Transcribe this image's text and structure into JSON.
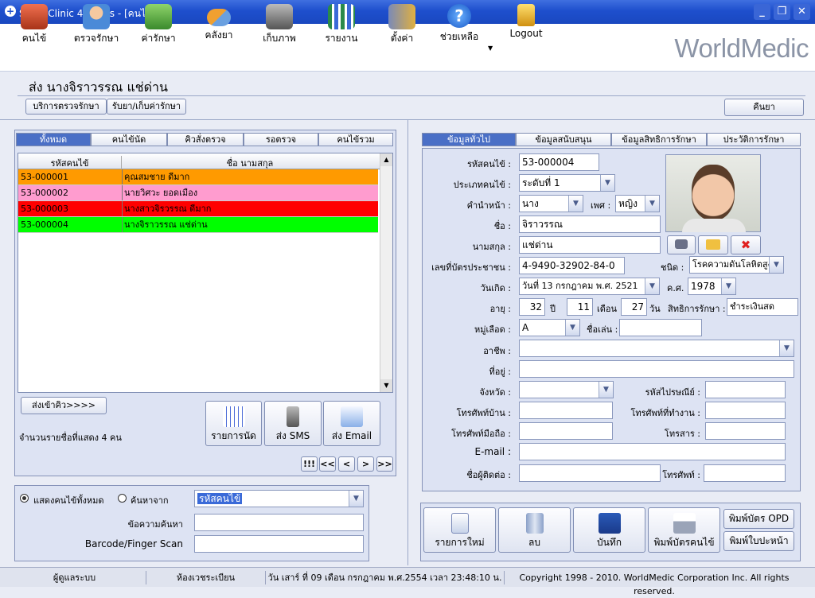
{
  "window": {
    "title": "SmartClinic 4.0 Plus - [คนไข้]"
  },
  "toolbar": {
    "items": [
      {
        "label": "คนไข้",
        "icon": "book-icon",
        "color": "#c84a2a"
      },
      {
        "label": "ตรวจรักษา",
        "icon": "doctor-icon",
        "color": "#4a8ad8"
      },
      {
        "label": "ค่ารักษา",
        "icon": "money-icon",
        "color": "#5aa83c"
      },
      {
        "label": "คลังยา",
        "icon": "pill-icon",
        "color": "#e08a2a"
      },
      {
        "label": "เก็บภาพ",
        "icon": "camera-icon",
        "color": "#6a6a6a"
      },
      {
        "label": "รายงาน",
        "icon": "chart-icon",
        "color": "#3a9a5a"
      },
      {
        "label": "ตั้งค่า",
        "icon": "tools-icon",
        "color": "#d0a030"
      },
      {
        "label": "ช่วยเหลือ",
        "icon": "help-icon",
        "color": "#2a7ad8"
      },
      {
        "label": "Logout",
        "icon": "lock-icon",
        "color": "#e8b830"
      }
    ],
    "brand": "WorldMedic"
  },
  "patient_header": {
    "name": "ส่ง  นางจิราวรรณ แช่ด่าน"
  },
  "subnav": {
    "service": "บริการตรวจรักษา",
    "pay": "รับยา/เก็บค่ารักษา",
    "reset": "คืนยา"
  },
  "left": {
    "tabs": [
      "ทั้งหมด",
      "คนไข้นัด",
      "คิวสั่งตรวจ",
      "รอตรวจ",
      "คนไข้รวม"
    ],
    "columns": [
      "รหัสคนไข้",
      "ชื่อ นามสกุล"
    ],
    "rows": [
      {
        "id": "53-000001",
        "name": "คุณสมชาย ดีมาก",
        "color": "#ff9a00"
      },
      {
        "id": "53-000002",
        "name": "นายวิศวะ ยอดเมือง",
        "color": "#ff9ccf"
      },
      {
        "id": "53-000003",
        "name": "นางสาวจิรวรรณ ดีมาก",
        "color": "#ff0000"
      },
      {
        "id": "53-000004",
        "name": "นางจิราวรรณ แช่ด่าน",
        "color": "#00ff00"
      }
    ],
    "send_queue": "ส่งเข้าคิว>>>>",
    "count_text": "จำนวนรายชื่อที่แสดง 4 คน",
    "actions": [
      "รายการนัด",
      "ส่ง SMS",
      "ส่ง Email"
    ],
    "nav": [
      "!!!",
      "<<",
      "<",
      ">",
      ">>"
    ],
    "search": {
      "radio_all": "แสดงคนไข้ทั้งหมด",
      "radio_search": "ค้นหาจาก",
      "search_by": "รหัสคนไข้",
      "text_label": "ข้อความค้นหา",
      "barcode_label": "Barcode/Finger Scan"
    }
  },
  "right": {
    "tabs": [
      "ข้อมูลทั่วไป",
      "ข้อมูลสนับสนุน",
      "ข้อมูลสิทธิการรักษา",
      "ประวัติการรักษา"
    ],
    "fields": {
      "hn_label": "รหัสคนไข้ :",
      "hn": "53-000004",
      "type_label": "ประเภทคนไข้ :",
      "type": "ระดับที่ 1",
      "prefix_label": "คำนำหน้า :",
      "prefix": "นาง",
      "sex_label": "เพศ :",
      "sex": "หญิง",
      "first_label": "ชื่อ :",
      "first": "จิราวรรณ",
      "last_label": "นามสกุล :",
      "last": "แช่ด่าน",
      "idcard_label": "เลขที่บัตรประชาชน :",
      "idcard": "4-9490-32902-84-0",
      "disease_label": "ชนิด :",
      "disease": "โรคความดันโลหิตสูง",
      "dob_label": "วันเกิด :",
      "dob": "วันที่ 13 กรกฎาคม  พ.ศ.  2521",
      "ce_label": "ค.ศ.",
      "ce": "1978",
      "age_label": "อายุ :",
      "age_y": "32",
      "y_unit": "ปี",
      "age_m": "11",
      "m_unit": "เดือน",
      "age_d": "27",
      "d_unit": "วัน",
      "right_label": "สิทธิการรักษา :",
      "right": "ชำระเงินสด",
      "blood_label": "หมู่เลือด :",
      "blood": "A",
      "nick_label": "ชื่อเล่น :",
      "job_label": "อาชีพ :",
      "addr_label": "ที่อยู่ :",
      "prov_label": "จังหวัด :",
      "zip_label": "รหัสไปรษณีย์ :",
      "home_label": "โทรศัพท์บ้าน :",
      "work_label": "โทรศัพท์ที่ทำงาน :",
      "mobile_label": "โทรศัพท์มือถือ :",
      "fax_label": "โทรสาร :",
      "email_label": "E-mail :",
      "contact_label": "ชื่อผู้ติดต่อ :",
      "contact_tel_label": "โทรศัพท์ :"
    },
    "actions": [
      "รายการใหม่",
      "ลบ",
      "บันทึก",
      "พิมพ์บัตรคนไข้"
    ],
    "print_opd": "พิมพ์บัตร OPD",
    "print_sheet": "พิมพ์ใบปะหน้า"
  },
  "status": {
    "user": "ผู้ดูแลระบบ",
    "room": "ห้องเวชระเบียน",
    "datetime": "วัน เสาร์ ที่ 09 เดือน กรกฎาคม พ.ศ.2554 เวลา 23:48:10 น.",
    "copyright": "Copyright 1998 - 2010. WorldMedic Corporation Inc. All rights reserved."
  }
}
